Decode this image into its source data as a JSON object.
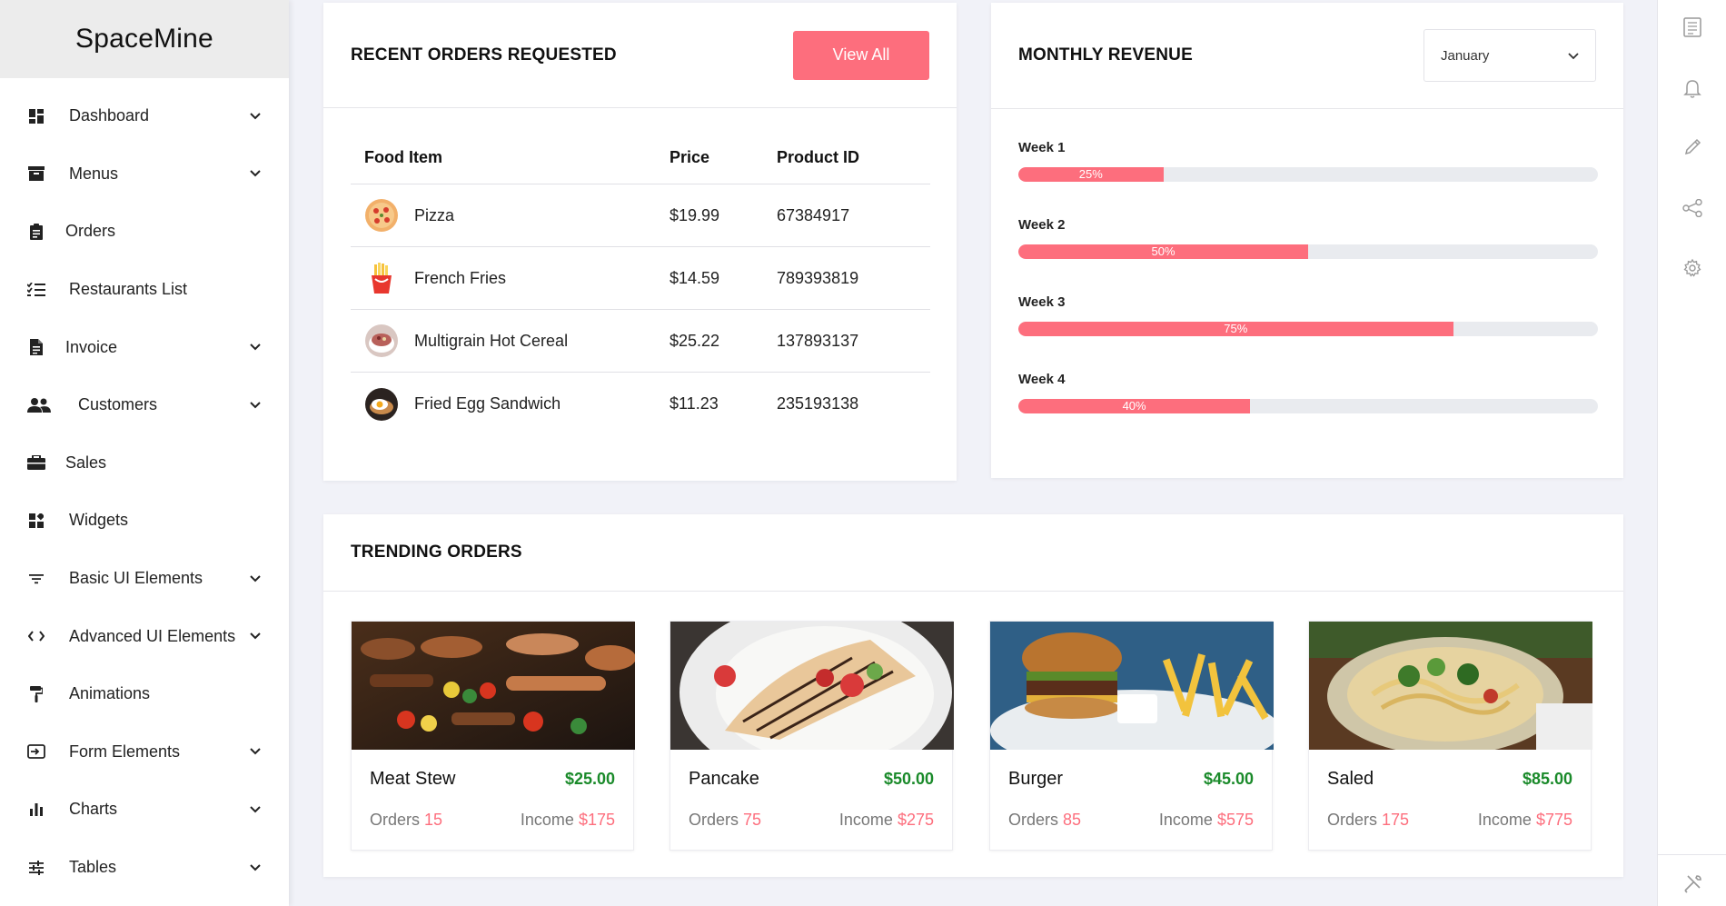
{
  "brand": "SpaceMine",
  "sidebar": {
    "items": [
      {
        "label": "Dashboard",
        "icon": "dashboard-icon",
        "has_children": true
      },
      {
        "label": "Menus",
        "icon": "menu-box-icon",
        "has_children": true
      },
      {
        "label": "Orders",
        "icon": "clipboard-icon",
        "has_children": false
      },
      {
        "label": "Restaurants List",
        "icon": "checklist-icon",
        "has_children": false
      },
      {
        "label": "Invoice",
        "icon": "document-icon",
        "has_children": true
      },
      {
        "label": "Customers",
        "icon": "users-icon",
        "has_children": true
      },
      {
        "label": "Sales",
        "icon": "briefcase-icon",
        "has_children": false
      },
      {
        "label": "Widgets",
        "icon": "widgets-icon",
        "has_children": false
      },
      {
        "label": "Basic UI Elements",
        "icon": "filter-icon",
        "has_children": true
      },
      {
        "label": "Advanced UI Elements",
        "icon": "code-icon",
        "has_children": true
      },
      {
        "label": "Animations",
        "icon": "paint-roller-icon",
        "has_children": false
      },
      {
        "label": "Form Elements",
        "icon": "login-icon",
        "has_children": true
      },
      {
        "label": "Charts",
        "icon": "bar-chart-icon",
        "has_children": true
      },
      {
        "label": "Tables",
        "icon": "sliders-icon",
        "has_children": true
      }
    ]
  },
  "recent_orders": {
    "title": "RECENT ORDERS REQUESTED",
    "view_all_label": "View All",
    "columns": [
      "Food Item",
      "Price",
      "Product ID"
    ],
    "rows": [
      {
        "item": "Pizza",
        "price": "$19.99",
        "id": "67384917",
        "icon": "pizza-icon"
      },
      {
        "item": "French Fries",
        "price": "$14.59",
        "id": "789393819",
        "icon": "fries-icon"
      },
      {
        "item": "Multigrain Hot Cereal",
        "price": "$25.22",
        "id": "137893137",
        "icon": "cereal-icon"
      },
      {
        "item": "Fried Egg Sandwich",
        "price": "$11.23",
        "id": "235193138",
        "icon": "sandwich-icon"
      }
    ]
  },
  "monthly_revenue": {
    "title": "MONTHLY REVENUE",
    "selected_month": "January",
    "weeks": [
      {
        "label": "Week 1",
        "percent": 25,
        "percent_label": "25%"
      },
      {
        "label": "Week 2",
        "percent": 50,
        "percent_label": "50%"
      },
      {
        "label": "Week 3",
        "percent": 75,
        "percent_label": "75%"
      },
      {
        "label": "Week 4",
        "percent": 40,
        "percent_label": "40%"
      }
    ]
  },
  "trending": {
    "title": "TRENDING ORDERS",
    "orders_label": "Orders",
    "income_label": "Income",
    "items": [
      {
        "name": "Meat Stew",
        "price": "$25.00",
        "orders": "15",
        "income": "$175"
      },
      {
        "name": "Pancake",
        "price": "$50.00",
        "orders": "75",
        "income": "$275"
      },
      {
        "name": "Burger",
        "price": "$45.00",
        "orders": "85",
        "income": "$575"
      },
      {
        "name": "Saled",
        "price": "$85.00",
        "orders": "175",
        "income": "$775"
      }
    ]
  },
  "rail": {
    "icons": [
      "list-icon",
      "bell-icon",
      "pencil-icon",
      "share-icon",
      "gear-icon",
      "tools-icon"
    ]
  },
  "colors": {
    "accent": "#fd6e7d",
    "price_green": "#1a8a2a",
    "background": "#f1f2f8"
  }
}
